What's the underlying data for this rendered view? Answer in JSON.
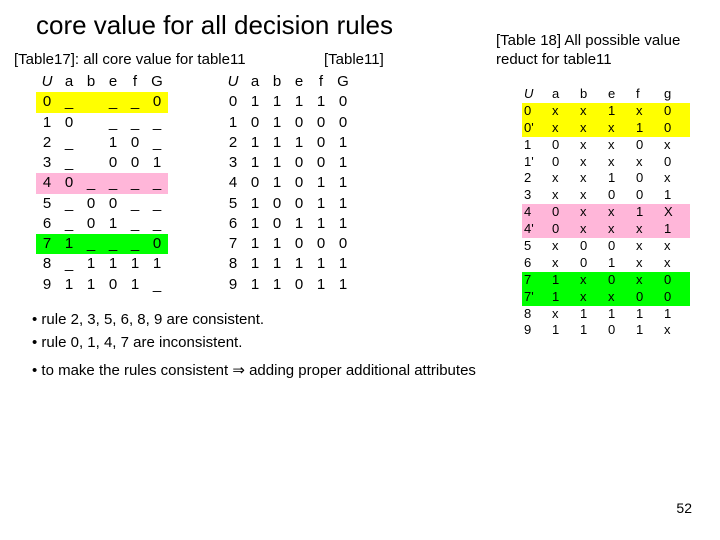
{
  "title": "core value for all decision rules",
  "cap17": "[Table17]: all core value for table11",
  "cap11": "[Table11]",
  "cap18": "[Table 18] All possible value reduct for table11",
  "headers": [
    "U",
    "a",
    "b",
    "e",
    "f",
    "G"
  ],
  "headers18": [
    "U",
    "a",
    "b",
    "e",
    "f",
    "g"
  ],
  "t17": [
    {
      "hl": "yellow",
      "c": [
        "0",
        "_",
        "",
        "_",
        "_",
        "0"
      ]
    },
    {
      "hl": "",
      "c": [
        "1",
        "0",
        "",
        "_",
        "_",
        "_"
      ]
    },
    {
      "hl": "",
      "c": [
        "2",
        "_",
        "",
        "1",
        "0",
        "_"
      ]
    },
    {
      "hl": "",
      "c": [
        "3",
        "_",
        "",
        "0",
        "0",
        "1"
      ]
    },
    {
      "hl": "pink",
      "c": [
        "4",
        "0",
        "_",
        "_",
        "_",
        "_"
      ]
    },
    {
      "hl": "",
      "c": [
        "5",
        "_",
        "0",
        "0",
        "_",
        "_"
      ]
    },
    {
      "hl": "",
      "c": [
        "6",
        "_",
        "0",
        "1",
        "_",
        "_"
      ]
    },
    {
      "hl": "green",
      "c": [
        "7",
        "1",
        "_",
        "_",
        "_",
        "0"
      ]
    },
    {
      "hl": "",
      "c": [
        "8",
        "_",
        "1",
        "1",
        "1",
        "1"
      ]
    },
    {
      "hl": "",
      "c": [
        "9",
        "1",
        "1",
        "0",
        "1",
        "_"
      ]
    }
  ],
  "t11": [
    {
      "hl": "",
      "c": [
        "0",
        "1",
        "1",
        "1",
        "1",
        "0"
      ]
    },
    {
      "hl": "",
      "c": [
        "1",
        "0",
        "1",
        "0",
        "0",
        "0"
      ]
    },
    {
      "hl": "",
      "c": [
        "2",
        "1",
        "1",
        "1",
        "0",
        "1"
      ]
    },
    {
      "hl": "",
      "c": [
        "3",
        "1",
        "1",
        "0",
        "0",
        "1"
      ]
    },
    {
      "hl": "",
      "c": [
        "4",
        "0",
        "1",
        "0",
        "1",
        "1"
      ]
    },
    {
      "hl": "",
      "c": [
        "5",
        "1",
        "0",
        "0",
        "1",
        "1"
      ]
    },
    {
      "hl": "",
      "c": [
        "6",
        "1",
        "0",
        "1",
        "1",
        "1"
      ]
    },
    {
      "hl": "",
      "c": [
        "7",
        "1",
        "1",
        "0",
        "0",
        "0"
      ]
    },
    {
      "hl": "",
      "c": [
        "8",
        "1",
        "1",
        "1",
        "1",
        "1"
      ]
    },
    {
      "hl": "",
      "c": [
        "9",
        "1",
        "1",
        "0",
        "1",
        "1"
      ]
    }
  ],
  "t18": [
    {
      "hl": "yellow",
      "c": [
        "0",
        "x",
        "x",
        "1",
        "x",
        "0"
      ]
    },
    {
      "hl": "yellow",
      "c": [
        "0'",
        "x",
        "x",
        "x",
        "1",
        "0"
      ]
    },
    {
      "hl": "",
      "c": [
        "1",
        "0",
        "x",
        "x",
        "0",
        "x"
      ]
    },
    {
      "hl": "",
      "c": [
        "1'",
        "0",
        "x",
        "x",
        "x",
        "0"
      ]
    },
    {
      "hl": "",
      "c": [
        "2",
        "x",
        "x",
        "1",
        "0",
        "x"
      ]
    },
    {
      "hl": "",
      "c": [
        "3",
        "x",
        "x",
        "0",
        "0",
        "1"
      ]
    },
    {
      "hl": "pink",
      "c": [
        "4",
        "0",
        "x",
        "x",
        "1",
        "X"
      ]
    },
    {
      "hl": "pink",
      "c": [
        "4'",
        "0",
        "x",
        "x",
        "x",
        "1"
      ]
    },
    {
      "hl": "",
      "c": [
        "5",
        "x",
        "0",
        "0",
        "x",
        "x"
      ]
    },
    {
      "hl": "",
      "c": [
        "6",
        "x",
        "0",
        "1",
        "x",
        "x"
      ]
    },
    {
      "hl": "green",
      "c": [
        "7",
        "1",
        "x",
        "0",
        "x",
        "0"
      ]
    },
    {
      "hl": "green",
      "c": [
        "7'",
        "1",
        "x",
        "x",
        "0",
        "0"
      ]
    },
    {
      "hl": "",
      "c": [
        "8",
        "x",
        "1",
        "1",
        "1",
        "1"
      ]
    },
    {
      "hl": "",
      "c": [
        "9",
        "1",
        "1",
        "0",
        "1",
        "x"
      ]
    }
  ],
  "bullet1": "• rule 2, 3, 5, 6, 8, 9 are consistent.",
  "bullet2": "• rule 0, 1, 4, 7 are inconsistent.",
  "bullet3": "• to make the rules consistent ⇒ adding proper additional attributes",
  "page": "52"
}
